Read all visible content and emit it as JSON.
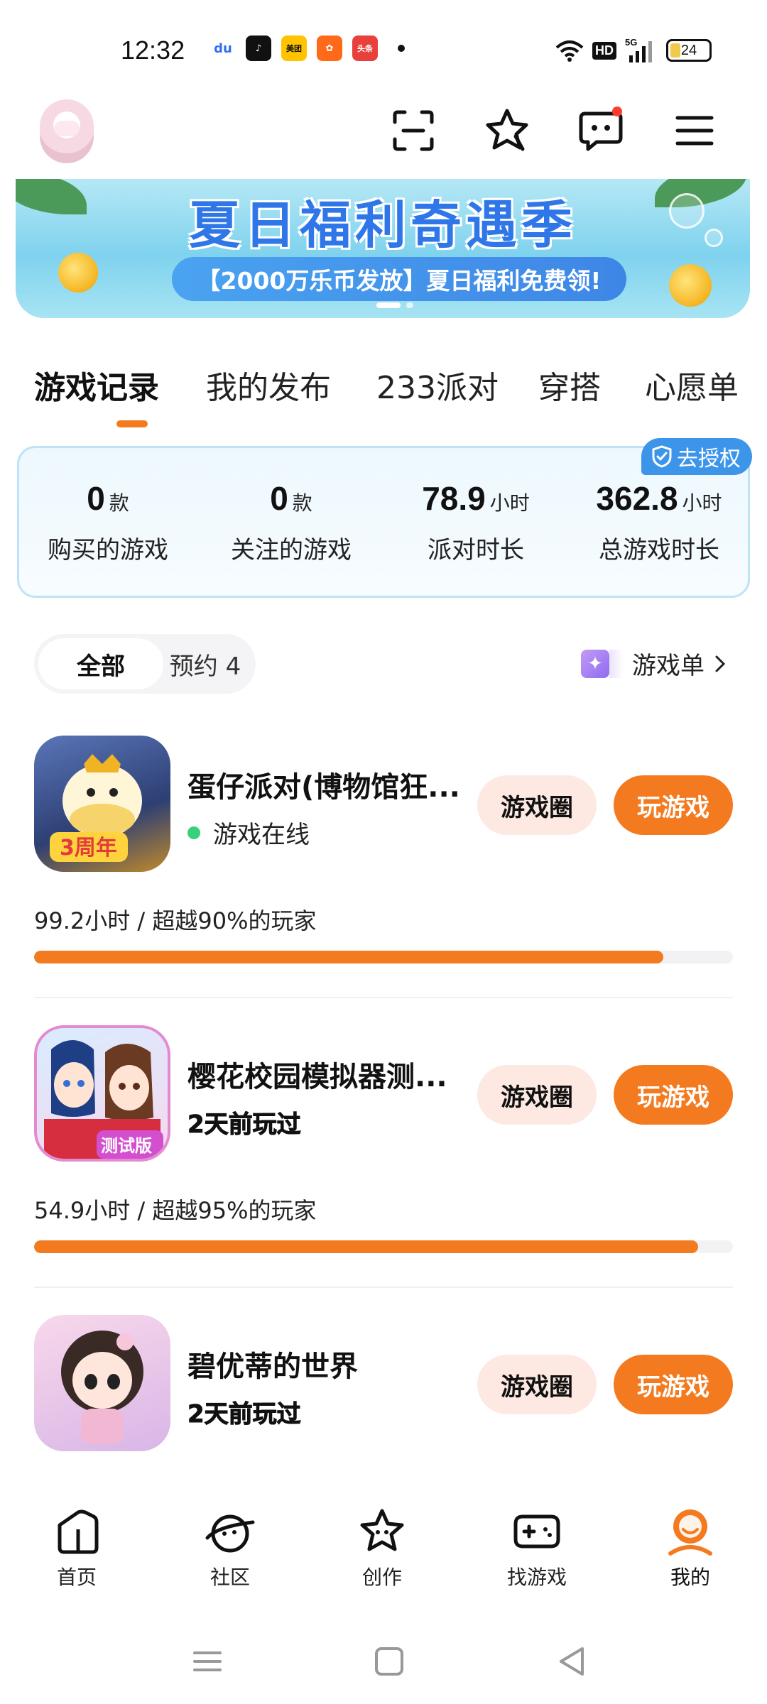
{
  "status_bar": {
    "time": "12:32",
    "notifications": [
      {
        "icon": "baidu-icon",
        "text": "du",
        "color": "#2f6ff0"
      },
      {
        "icon": "tiktok-icon",
        "text": "♪",
        "color": "#111111"
      },
      {
        "icon": "meituan-icon",
        "text": "美团",
        "color": "#ffc300"
      },
      {
        "icon": "kuaishou-icon",
        "text": "✿",
        "color": "#ff6a1a"
      },
      {
        "icon": "toutiao-icon",
        "text": "头条",
        "color": "#e8403a"
      }
    ],
    "network": "5G",
    "hd": "HD",
    "battery": "24"
  },
  "header": {
    "avatar": "avatar",
    "icons": [
      "scan-icon",
      "star-icon",
      "message-icon",
      "menu-icon"
    ]
  },
  "banner": {
    "title": "夏日福利奇遇季",
    "subtitle": "【2000万乐币发放】夏日福利免费领!"
  },
  "tabs": [
    {
      "label": "游戏记录",
      "active": true
    },
    {
      "label": "我的发布"
    },
    {
      "label": "233派对"
    },
    {
      "label": "穿搭"
    },
    {
      "label": "心愿单"
    }
  ],
  "auth_badge": "去授权",
  "stats": [
    {
      "value": "0",
      "unit": "款",
      "label": "购买的游戏"
    },
    {
      "value": "0",
      "unit": "款",
      "label": "关注的游戏"
    },
    {
      "value": "78.9",
      "unit": "小时",
      "label": "派对时长"
    },
    {
      "value": "362.8",
      "unit": "小时",
      "label": "总游戏时长"
    }
  ],
  "filter": {
    "all": "全部",
    "reserve": "预约 4"
  },
  "game_list_link": "游戏单",
  "games": [
    {
      "title": "蛋仔派对(博物馆狂...",
      "status": "游戏在线",
      "online": true,
      "hours": "99.2小时 / 超越90%的玩家",
      "progress_pct": 90,
      "circle_label": "游戏圈",
      "play_label": "玩游戏",
      "icon_badge": "3周年"
    },
    {
      "title": "樱花校园模拟器测...",
      "status": "2天前玩过",
      "online": false,
      "hours": "54.9小时 / 超越95%的玩家",
      "progress_pct": 95,
      "circle_label": "游戏圈",
      "play_label": "玩游戏",
      "icon_badge": "测试版"
    },
    {
      "title": "碧优蒂的世界",
      "status": "2天前玩过",
      "online": false,
      "circle_label": "游戏圈",
      "play_label": "玩游戏"
    }
  ],
  "bottom_nav": [
    {
      "label": "首页",
      "icon": "home-icon"
    },
    {
      "label": "社区",
      "icon": "community-icon"
    },
    {
      "label": "创作",
      "icon": "create-icon"
    },
    {
      "label": "找游戏",
      "icon": "gamepad-icon"
    },
    {
      "label": "我的",
      "icon": "profile-icon",
      "active": true
    }
  ],
  "colors": {
    "accent": "#f47a1f",
    "auth": "#3d95ea",
    "online": "#39d07b"
  }
}
